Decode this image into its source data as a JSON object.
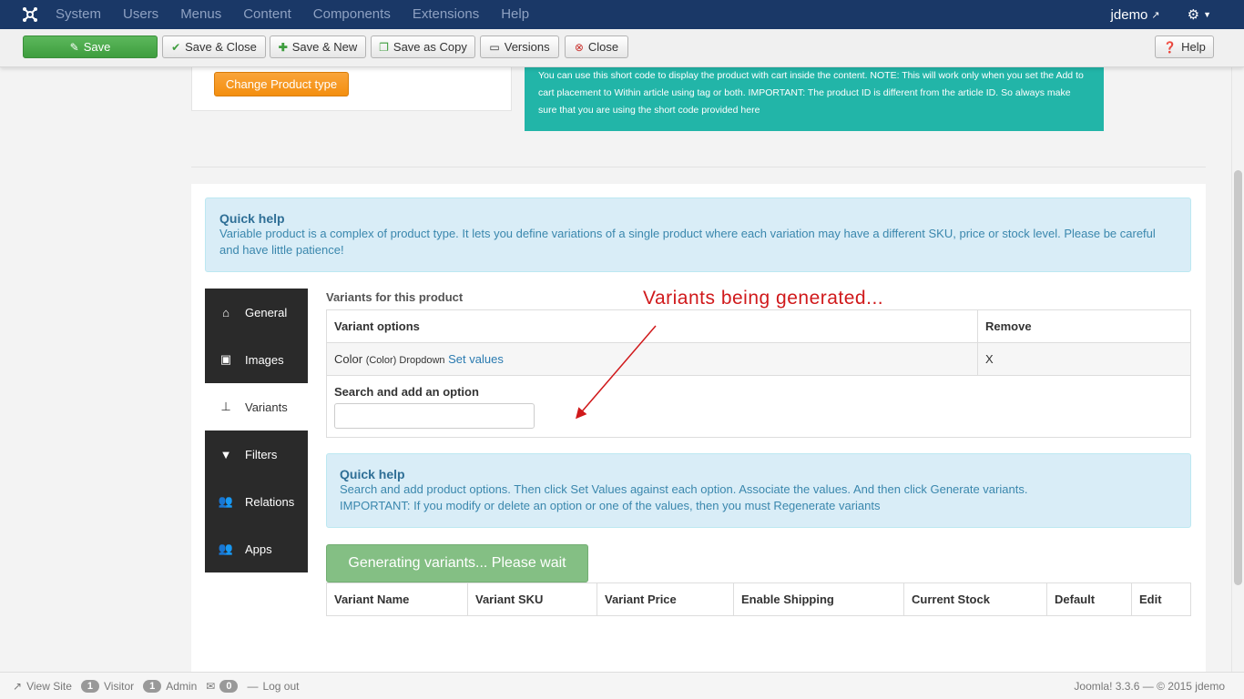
{
  "navbar": {
    "menu": [
      "System",
      "Users",
      "Menus",
      "Content",
      "Components",
      "Extensions",
      "Help"
    ],
    "username": "jdemo"
  },
  "toolbar": {
    "save": "Save",
    "save_close": "Save & Close",
    "save_new": "Save & New",
    "save_copy": "Save as Copy",
    "versions": "Versions",
    "close": "Close",
    "help": "Help"
  },
  "top": {
    "change_type": "Change Product type",
    "shortcode_note": "You can use this short code to display the product with cart inside the content. NOTE: This will work only when you set the Add to cart placement to Within article using tag or both. IMPORTANT: The product ID is different from the article ID. So always make sure that you are using the short code provided here"
  },
  "quick_help_main": {
    "title": "Quick help",
    "text": "Variable product is a complex of product type. It lets you define variations of a single product where each variation may have a different SKU, price or stock level. Please be careful and have little patience!"
  },
  "tabs": [
    {
      "label": "General",
      "icon": "home-icon"
    },
    {
      "label": "Images",
      "icon": "image-icon"
    },
    {
      "label": "Variants",
      "icon": "sitemap-icon"
    },
    {
      "label": "Filters",
      "icon": "filter-icon"
    },
    {
      "label": "Relations",
      "icon": "users-icon"
    },
    {
      "label": "Apps",
      "icon": "users-icon"
    }
  ],
  "variants": {
    "heading": "Variants for this product",
    "col_options": "Variant options",
    "col_remove": "Remove",
    "option_name": "Color",
    "option_meta": "(Color) Dropdown",
    "set_values": "Set values",
    "remove_x": "X",
    "search_label": "Search and add an option",
    "search_value": ""
  },
  "annotation": "Variants being generated...",
  "quick_help_variants": {
    "title": "Quick help",
    "line1": "Search and add product options. Then click Set Values against each option. Associate the values. And then click Generate variants.",
    "line2": "IMPORTANT: If you modify or delete an option or one of the values, then you must Regenerate variants"
  },
  "generate_button": "Generating variants... Please wait",
  "variant_columns": [
    "Variant Name",
    "Variant SKU",
    "Variant Price",
    "Enable Shipping",
    "Current Stock",
    "Default",
    "Edit"
  ],
  "statusbar": {
    "view_site": "View Site",
    "visitor_count": "1",
    "visitor": "Visitor",
    "admin_count": "1",
    "admin": "Admin",
    "messages": "0",
    "logout": "Log out",
    "version": "Joomla! 3.3.6 — © 2015 jdemo"
  },
  "colors": {
    "navbar": "#1a3867",
    "save": "#5cb85c",
    "teal": "#22b5a8",
    "orange": "#f48f0f",
    "annotation": "#d0191b"
  }
}
